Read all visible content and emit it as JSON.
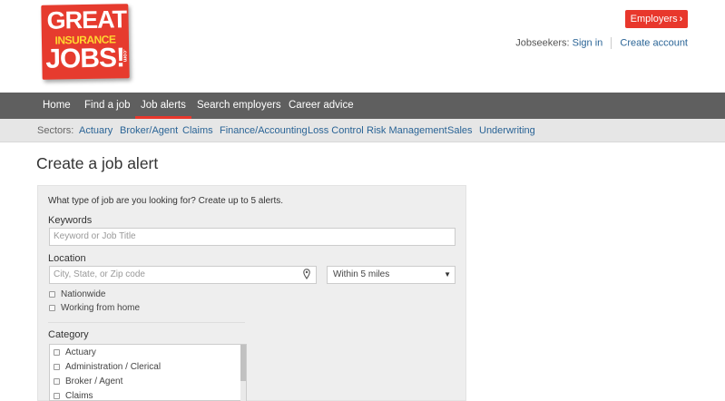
{
  "logo": {
    "line1": "GREAT",
    "line2": "INSURANCE",
    "line3": "JOBS!",
    "line4": ".com"
  },
  "header": {
    "employers_button": "Employers",
    "jobseekers_label": "Jobseekers:",
    "sign_in": "Sign in",
    "create_account": "Create account"
  },
  "nav": {
    "items": [
      "Home",
      "Find a job",
      "Job alerts",
      "Search employers",
      "Career advice"
    ],
    "active": "Job alerts"
  },
  "sectors": {
    "label": "Sectors:",
    "items": [
      "Actuary",
      "Broker/Agent",
      "Claims",
      "Finance/Accounting",
      "Loss Control",
      "Risk Management",
      "Sales",
      "Underwriting"
    ]
  },
  "page": {
    "title": "Create a job alert"
  },
  "form": {
    "intro": "What type of job are you looking for? Create up to 5 alerts.",
    "keywords_label": "Keywords",
    "keywords_placeholder": "Keyword or Job Title",
    "location_label": "Location",
    "location_placeholder": "City, State, or Zip code",
    "radius_value": "Within 5 miles",
    "nationwide_label": "Nationwide",
    "home_label": "Working from home",
    "category_label": "Category",
    "categories": [
      "Actuary",
      "Administration / Clerical",
      "Broker / Agent",
      "Claims"
    ]
  },
  "colors": {
    "accent": "#e8372c",
    "nav_bg": "#5f5f5f",
    "link": "#2a6496"
  }
}
